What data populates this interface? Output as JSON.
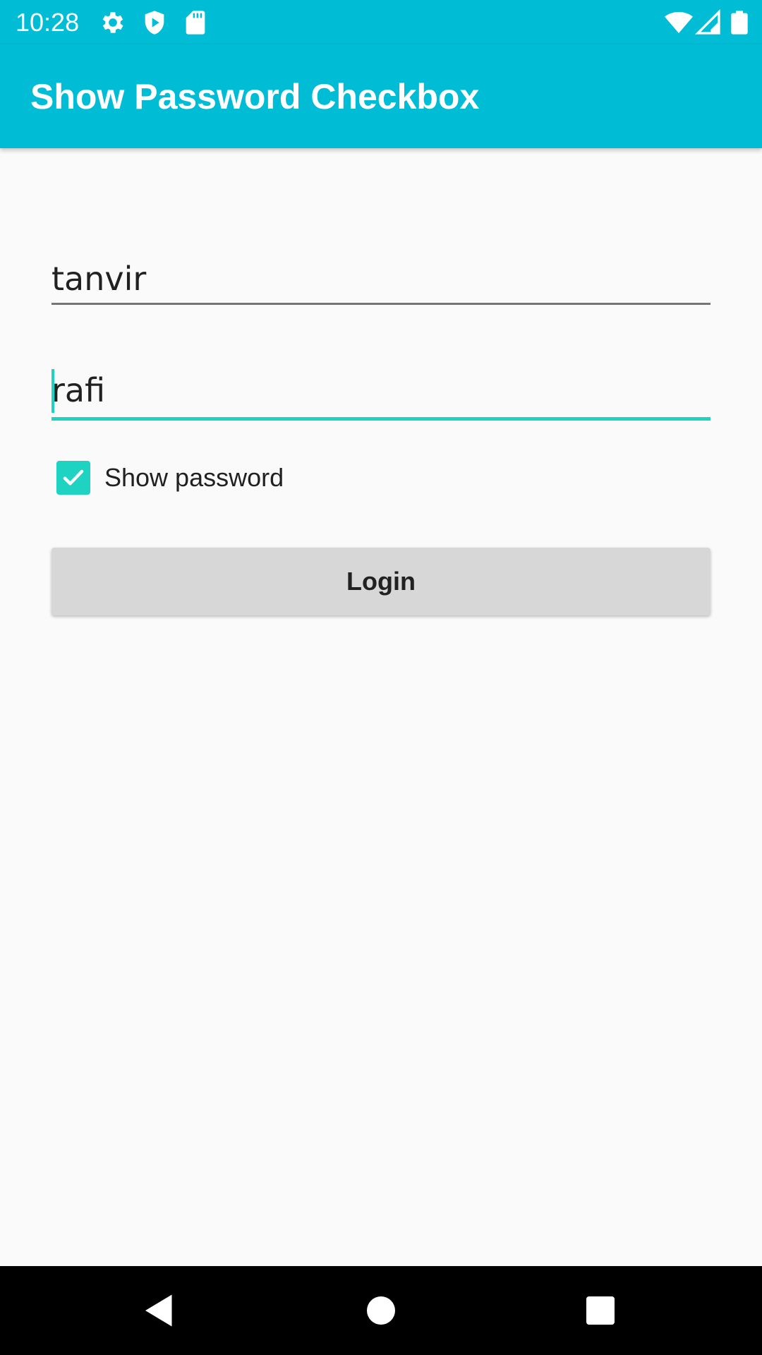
{
  "status_bar": {
    "time": "10:28",
    "icons_left": [
      "gear-icon",
      "shield-play-icon",
      "sd-card-icon"
    ],
    "icons_right": [
      "wifi-icon",
      "signal-icon",
      "battery-icon"
    ]
  },
  "app_bar": {
    "title": "Show Password Checkbox",
    "color": "#00bcd4"
  },
  "form": {
    "username_value": "tanvir",
    "password_value": "rafi",
    "show_password_label": "Show password",
    "show_password_checked": true,
    "login_label": "Login",
    "accent_color": "#1ed3c2"
  },
  "nav_bar": {
    "buttons": [
      "back-icon",
      "home-icon",
      "recents-icon"
    ]
  }
}
